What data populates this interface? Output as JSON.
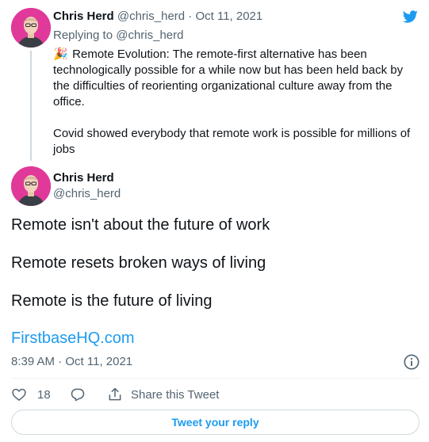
{
  "reply_tweet": {
    "name": "Chris Herd",
    "handle": "@chris_herd",
    "separator": "·",
    "date": "Oct 11, 2021",
    "replying_prefix": "Replying to",
    "replying_to": "@chris_herd",
    "emoji": "🎉",
    "paragraph1": "Remote Evolution: The remote-first alternative has been technologically possible for a while now but has been held back by the difficulties of reorienting organizational culture away from the office.",
    "paragraph2": "Covid showed everybody that remote work is possible for millions of jobs"
  },
  "main_tweet": {
    "name": "Chris Herd",
    "handle": "@chris_herd",
    "line1": "Remote isn't about the future of work",
    "line2": "Remote resets broken ways of living",
    "line3": "Remote is the future of living",
    "link": "FirstbaseHQ.com",
    "timestamp": "8:39 AM · Oct 11, 2021"
  },
  "actions": {
    "like_count": "18",
    "share_label": "Share this Tweet"
  },
  "reply_button": "Tweet your reply",
  "colors": {
    "accent": "#1d9bf0",
    "avatar_bg": "#e0399a",
    "secondary_text": "#536471"
  },
  "icons": {
    "logo": "twitter-bird-icon",
    "info": "info-icon",
    "like": "heart-icon",
    "reply": "comment-icon",
    "share": "share-icon"
  }
}
